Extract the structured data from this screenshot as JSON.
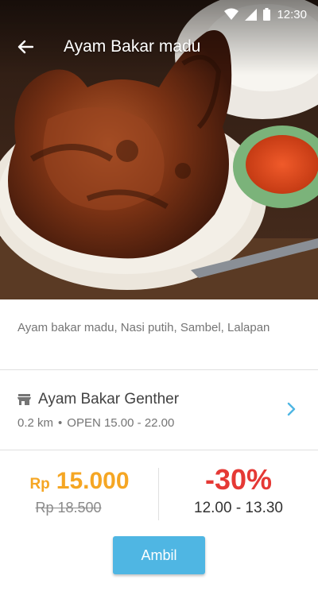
{
  "status_bar": {
    "time": "12:30"
  },
  "app_bar": {
    "title": "Ayam Bakar madu",
    "back_icon": "arrow-left-icon"
  },
  "hero_image": {
    "subject": "grilled honey chicken with sambal and rice"
  },
  "menu": {
    "description": "Ayam bakar madu, Nasi putih, Sambel, Lalapan"
  },
  "merchant": {
    "icon": "store-icon",
    "name": "Ayam Bakar Genther",
    "distance": "0.2 km",
    "separator": "•",
    "hours": "OPEN 15.00 - 22.00",
    "chevron_icon": "chevron-right-icon"
  },
  "pricing": {
    "currency": "Rp",
    "price": "15.000",
    "old_price": "Rp 18.500",
    "discount": "-30%",
    "time_window": "12.00 - 13.30"
  },
  "actions": {
    "ambil_label": "Ambil"
  },
  "colors": {
    "accent_blue": "#4fb6e3",
    "price_orange": "#f5a623",
    "discount_red": "#e53935"
  }
}
